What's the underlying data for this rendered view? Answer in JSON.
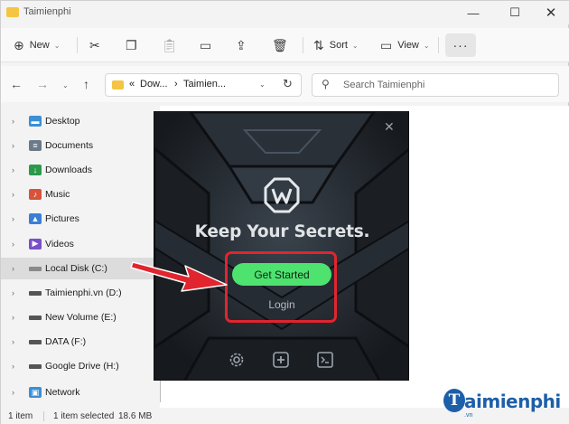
{
  "window": {
    "title": "Taimienphi",
    "controls": [
      "—",
      "☐",
      "✕"
    ]
  },
  "toolbar": {
    "new_label": "New",
    "sort_label": "Sort",
    "view_label": "View",
    "more_label": "···"
  },
  "address": {
    "prefix": "«",
    "crumbs": [
      "Dow...",
      "Taimien..."
    ],
    "separator": "›",
    "search_placeholder": "Search Taimienphi"
  },
  "sidebar": {
    "items": [
      {
        "label": "Desktop",
        "icon": "desktop-icon",
        "color": "#3a8fd6"
      },
      {
        "label": "Documents",
        "icon": "documents-icon",
        "color": "#6b7a88"
      },
      {
        "label": "Downloads",
        "icon": "downloads-icon",
        "color": "#2a9a4a"
      },
      {
        "label": "Music",
        "icon": "music-icon",
        "color": "#d8533a"
      },
      {
        "label": "Pictures",
        "icon": "pictures-icon",
        "color": "#3a7fd6"
      },
      {
        "label": "Videos",
        "icon": "videos-icon",
        "color": "#7b4fc9"
      },
      {
        "label": "Local Disk (C:)",
        "icon": "drive-icon",
        "color": "#8a8a8a"
      },
      {
        "label": "Taimienphi.vn (D:)",
        "icon": "drive-icon",
        "color": "#555555"
      },
      {
        "label": "New Volume (E:)",
        "icon": "drive-icon",
        "color": "#555555"
      },
      {
        "label": "DATA (F:)",
        "icon": "drive-icon",
        "color": "#555555"
      },
      {
        "label": "Google Drive (H:)",
        "icon": "drive-icon",
        "color": "#555555"
      },
      {
        "label": "Network",
        "icon": "network-icon",
        "color": "#3a8fd6"
      }
    ],
    "selected_index": 6
  },
  "status": {
    "count": "1 item",
    "selected": "1 item selected",
    "size": "18.6 MB"
  },
  "dialog": {
    "headline": "Keep Your Secrets.",
    "primary_button": "Get Started",
    "secondary_button": "Login",
    "accent_color": "#4ee26f",
    "bottom_icons": [
      "settings-icon",
      "plus-icon",
      "terminal-icon"
    ]
  },
  "annotation": {
    "highlight_color": "#e0252f"
  },
  "watermark": {
    "brand": "aimienphi",
    "letter": "T",
    "sub": ".vn"
  }
}
